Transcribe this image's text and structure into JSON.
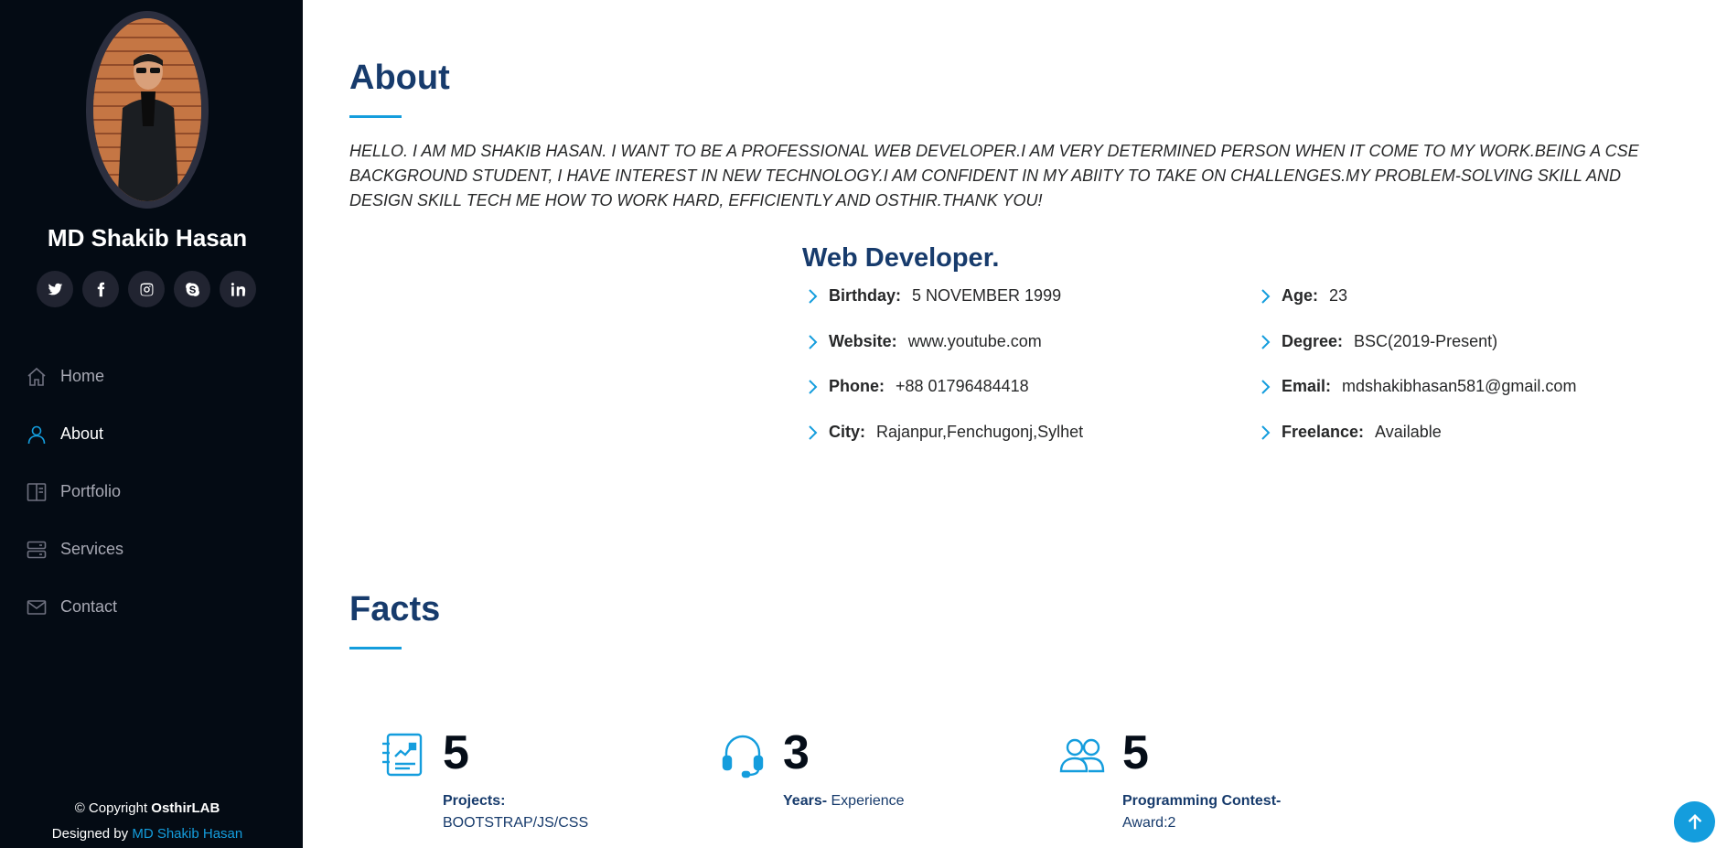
{
  "sidebar": {
    "name": "MD Shakib Hasan",
    "socials": [
      "twitter-icon",
      "facebook-icon",
      "instagram-icon",
      "skype-icon",
      "linkedin-icon"
    ],
    "nav": [
      {
        "label": "Home",
        "icon": "home-icon",
        "active": false
      },
      {
        "label": "About",
        "icon": "person-icon",
        "active": true
      },
      {
        "label": "Portfolio",
        "icon": "book-icon",
        "active": false
      },
      {
        "label": "Services",
        "icon": "server-icon",
        "active": false
      },
      {
        "label": "Contact",
        "icon": "envelope-icon",
        "active": false
      }
    ],
    "footer": {
      "copyright_prefix": "© Copyright",
      "copyright_brand": "OsthirLAB",
      "designed_prefix": "Designed by",
      "designed_link": "MD Shakib Hasan"
    }
  },
  "about": {
    "title": "About",
    "text": "HELLO. I AM MD SHAKIB HASAN. I WANT TO BE A PROFESSIONAL WEB DEVELOPER.I AM VERY DETERMINED PERSON WHEN IT COME TO MY WORK.BEING A CSE BACKGROUND STUDENT, I HAVE INTEREST IN NEW TECHNOLOGY.I AM CONFIDENT IN MY ABIITY TO TAKE ON CHALLENGES.MY PROBLEM-SOLVING SKILL AND DESIGN SKILL TECH ME HOW TO WORK HARD, EFFICIENTLY AND OSTHIR.THANK YOU!",
    "role": "Web Developer.",
    "left_info": [
      {
        "label": "Birthday:",
        "value": "5 NOVEMBER 1999"
      },
      {
        "label": "Website:",
        "value": "www.youtube.com"
      },
      {
        "label": "Phone:",
        "value": "+88 01796484418"
      },
      {
        "label": "City:",
        "value": "Rajanpur,Fenchugonj,Sylhet"
      }
    ],
    "right_info": [
      {
        "label": "Age:",
        "value": "23"
      },
      {
        "label": "Degree:",
        "value": "BSC(2019-Present)"
      },
      {
        "label": "Email:",
        "value": "mdshakibhasan581@gmail.com"
      },
      {
        "label": "Freelance:",
        "value": "Available"
      }
    ]
  },
  "facts": {
    "title": "Facts",
    "items": [
      {
        "icon": "journal-richtext-icon",
        "number": "5",
        "label": "Projects:",
        "detail": "BOOTSTRAP/JS/CSS"
      },
      {
        "icon": "headset-icon",
        "number": "3",
        "label": "Years-",
        "detail": "Experience"
      },
      {
        "icon": "people-icon",
        "number": "5",
        "label": "Programming Contest-",
        "detail": "Award:2"
      }
    ]
  },
  "colors": {
    "accent": "#149ddd",
    "heading": "#173b6c",
    "sidebar": "#040b14"
  }
}
